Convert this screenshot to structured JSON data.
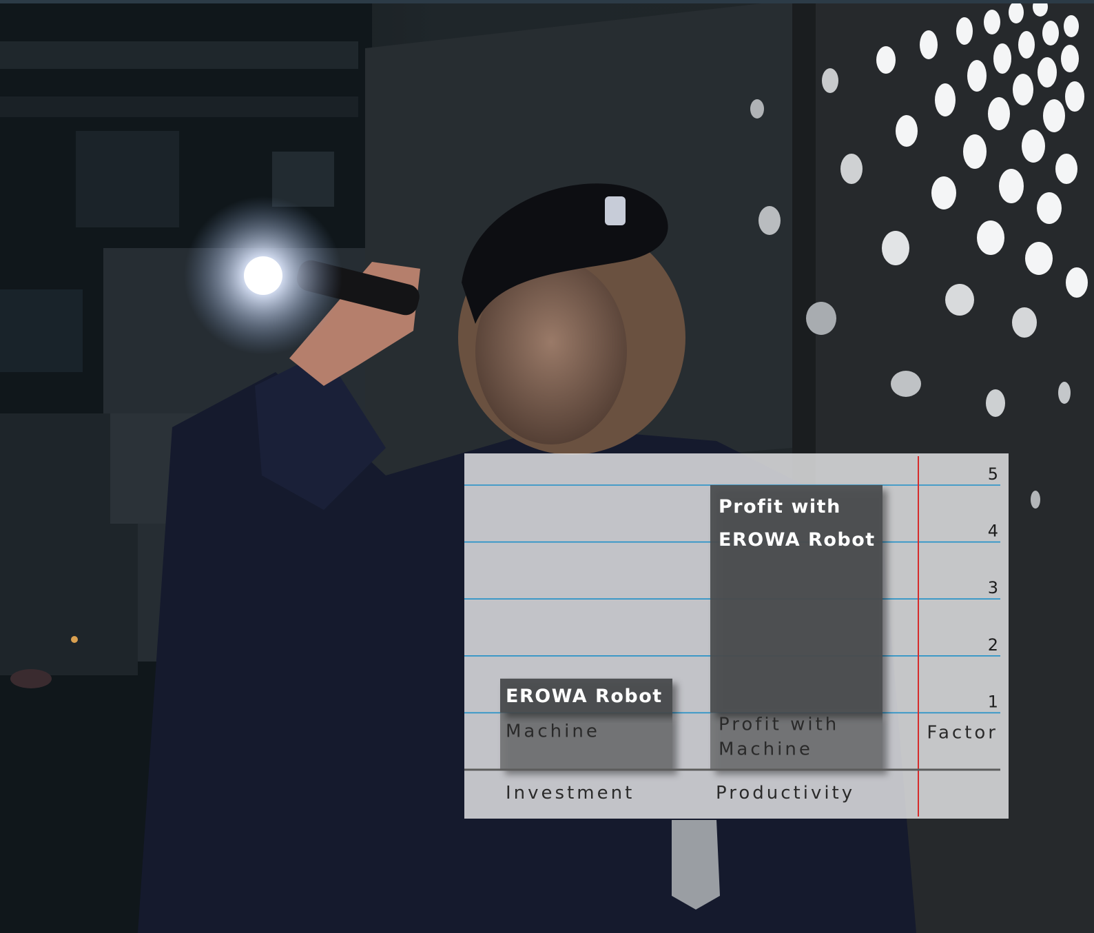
{
  "chart_data": {
    "type": "bar",
    "categories": [
      "Investment",
      "Productivity"
    ],
    "ylabel": "Factor",
    "yticks": [
      1,
      2,
      3,
      4,
      5
    ],
    "ylim": [
      0,
      5.6
    ],
    "grid": true,
    "series": [
      {
        "name": "Machine",
        "values": [
          1,
          1
        ]
      },
      {
        "name": "EROWA Robot",
        "values": [
          0.6,
          0
        ]
      },
      {
        "name": "Profit with EROWA Robot",
        "values": [
          0,
          4
        ]
      }
    ],
    "bar_labels": {
      "investment_base": "Machine",
      "investment_top": "EROWA Robot",
      "productivity_base": [
        "Profit with",
        "Machine"
      ],
      "productivity_top": [
        "Profit with",
        "EROWA Robot"
      ]
    },
    "colors": {
      "panel": "#e9e9ea",
      "gridline": "#1e8fc7",
      "axis_line": "#d62a2a",
      "base_bar": "#6e6f71",
      "top_bar": "#4a4b4e",
      "baseline": "#5c5c5c"
    }
  }
}
